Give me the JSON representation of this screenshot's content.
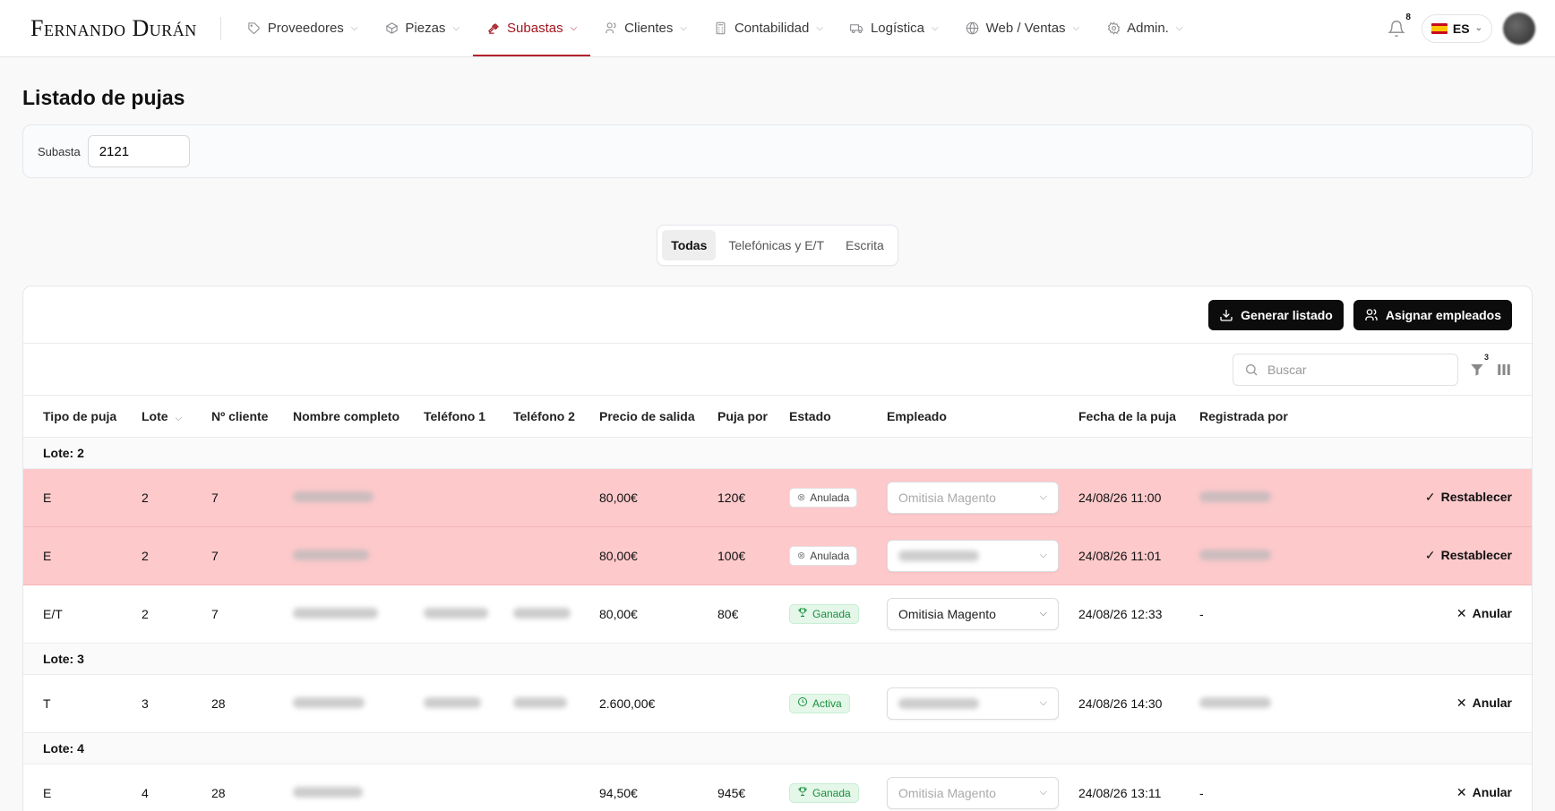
{
  "brand": "Fernando Durán",
  "nav": [
    {
      "label": "Proveedores",
      "icon": "tag-icon",
      "active": false
    },
    {
      "label": "Piezas",
      "icon": "box-icon",
      "active": false
    },
    {
      "label": "Subastas",
      "icon": "gavel-icon",
      "active": true
    },
    {
      "label": "Clientes",
      "icon": "users-icon",
      "active": false
    },
    {
      "label": "Contabilidad",
      "icon": "calculator-icon",
      "active": false
    },
    {
      "label": "Logística",
      "icon": "truck-icon",
      "active": false
    },
    {
      "label": "Web / Ventas",
      "icon": "globe-icon",
      "active": false
    },
    {
      "label": "Admin.",
      "icon": "settings-icon",
      "active": false
    }
  ],
  "notifications": {
    "count": "8"
  },
  "language": "ES",
  "page_title": "Listado de pujas",
  "filter": {
    "label": "Subasta",
    "value": "2121"
  },
  "tabs": [
    {
      "label": "Todas",
      "active": true
    },
    {
      "label": "Telefónicas y E/T",
      "active": false
    },
    {
      "label": "Escrita",
      "active": false
    }
  ],
  "actions": {
    "generate": "Generar listado",
    "assign": "Asignar empleados"
  },
  "search": {
    "placeholder": "Buscar"
  },
  "filter_badge": "3",
  "columns": [
    "Tipo de puja",
    "Lote",
    "Nº cliente",
    "Nombre completo",
    "Teléfono 1",
    "Teléfono 2",
    "Precio de salida",
    "Puja por",
    "Estado",
    "Empleado",
    "Fecha de la puja",
    "Registrada por"
  ],
  "groups": [
    {
      "label": "Lote: 2",
      "rows": [
        {
          "tipo": "E",
          "lote": "2",
          "cliente": "7",
          "precio": "80,00€",
          "puja": "120€",
          "estado": "Anulada",
          "estado_kind": "voided",
          "empleado": "Omitisia Magento",
          "empleado_dim": true,
          "fecha": "24/08/26 11:00",
          "registrada": "",
          "action": "Restablecer",
          "action_sym": "✓",
          "voided": true
        },
        {
          "tipo": "E",
          "lote": "2",
          "cliente": "7",
          "precio": "80,00€",
          "puja": "100€",
          "estado": "Anulada",
          "estado_kind": "voided",
          "empleado": "",
          "empleado_dim": true,
          "fecha": "24/08/26 11:01",
          "registrada": "",
          "action": "Restablecer",
          "action_sym": "✓",
          "voided": true
        },
        {
          "tipo": "E/T",
          "lote": "2",
          "cliente": "7",
          "precio": "80,00€",
          "puja": "80€",
          "estado": "Ganada",
          "estado_kind": "won",
          "empleado": "Omitisia Magento",
          "empleado_dim": false,
          "fecha": "24/08/26 12:33",
          "registrada": "-",
          "action": "Anular",
          "action_sym": "✕",
          "voided": false
        }
      ]
    },
    {
      "label": "Lote: 3",
      "rows": [
        {
          "tipo": "T",
          "lote": "3",
          "cliente": "28",
          "precio": "2.600,00€",
          "puja": "",
          "estado": "Activa",
          "estado_kind": "active",
          "empleado": "",
          "empleado_dim": true,
          "fecha": "24/08/26 14:30",
          "registrada": "",
          "action": "Anular",
          "action_sym": "✕",
          "voided": false
        }
      ]
    },
    {
      "label": "Lote: 4",
      "rows": [
        {
          "tipo": "E",
          "lote": "4",
          "cliente": "28",
          "precio": "94,50€",
          "puja": "945€",
          "estado": "Ganada",
          "estado_kind": "won",
          "empleado": "Omitisia Magento",
          "empleado_dim": true,
          "fecha": "24/08/26 13:11",
          "registrada": "-",
          "action": "Anular",
          "action_sym": "✕",
          "voided": false
        }
      ]
    }
  ]
}
